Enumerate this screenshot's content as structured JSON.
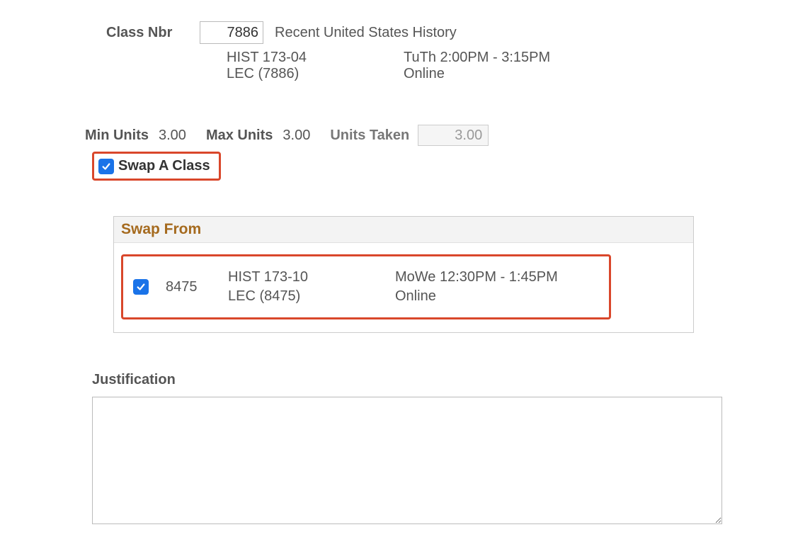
{
  "classNbr": {
    "label": "Class Nbr",
    "value": "7886",
    "title": "Recent United States History",
    "course": "HIST 173-04",
    "section": "LEC (7886)",
    "schedule": "TuTh 2:00PM - 3:15PM",
    "location": "Online"
  },
  "units": {
    "minLabel": "Min Units",
    "minValue": "3.00",
    "maxLabel": "Max Units",
    "maxValue": "3.00",
    "takenLabel": "Units Taken",
    "takenValue": "3.00"
  },
  "swapToggle": {
    "label": "Swap A Class",
    "checked": true
  },
  "swapFrom": {
    "heading": "Swap From",
    "entry": {
      "checked": true,
      "nbr": "8475",
      "course": "HIST 173-10",
      "section": "LEC (8475)",
      "schedule": "MoWe 12:30PM - 1:45PM",
      "location": "Online"
    }
  },
  "justification": {
    "label": "Justification",
    "value": ""
  }
}
